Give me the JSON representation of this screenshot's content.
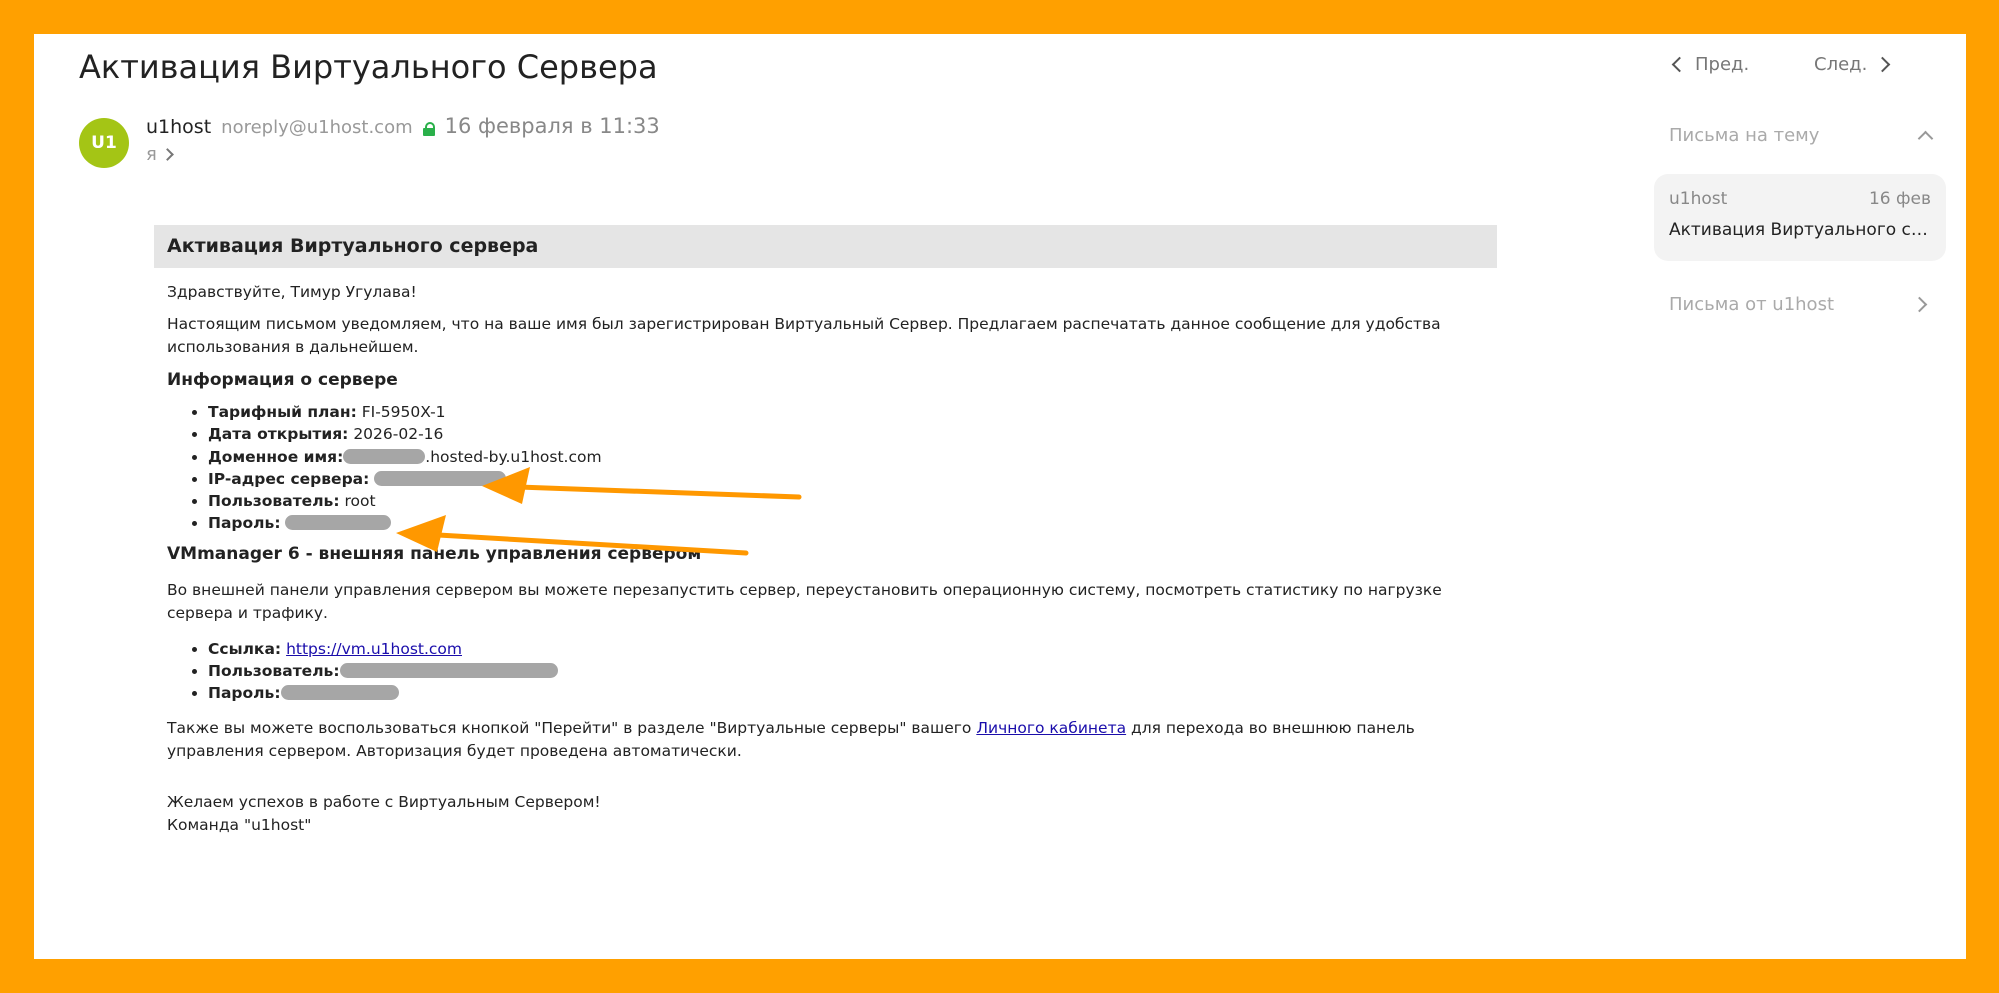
{
  "message": {
    "title": "Активация Виртуального Сервера",
    "avatar_initials": "U1",
    "sender_name": "u1host",
    "sender_email": "noreply@u1host.com",
    "date": "16 февраля в 11:33",
    "recipient": "я"
  },
  "body": {
    "header": "Активация Виртуального сервера",
    "greeting": "Здравствуйте, Тимур Угулава!",
    "intro": "Настоящим письмом уведомляем, что на ваше имя был зарегистрирован Виртуальный Сервер. Предлагаем распечатать данное сообщение для удобства использования в дальнейшем.",
    "server_info_title": "Информация о сервере",
    "server_info": {
      "plan_label": "Тарифный план:",
      "plan_value": "FI-5950X-1",
      "open_date_label": "Дата открытия:",
      "open_date_value": "2026-02-16",
      "domain_label": "Доменное имя:",
      "domain_suffix": ".hosted-by.u1host.com",
      "ip_label": "IP-адрес сервера:",
      "user_label": "Пользователь:",
      "user_value": "root",
      "password_label": "Пароль:"
    },
    "panel_title": "VMmanager 6 - внешняя панель управления сервером",
    "panel_desc": "Во внешней панели управления сервером вы можете перезапустить сервер, переустановить операционную систему, посмотреть статистику по нагрузке сервера и трафику.",
    "panel_info": {
      "link_label": "Ссылка:",
      "link_value": "https://vm.u1host.com",
      "user_label": "Пользователь:",
      "password_label": "Пароль:"
    },
    "also_before": "Также вы можете воспользоваться кнопкой \"Перейти\" в разделе \"Виртуальные серверы\" вашего ",
    "cabinet_link": "Личного кабинета",
    "also_after": " для перехода во внешнюю панель управления сервером. Авторизация будет проведена автоматически.",
    "closing": "Желаем успехов в работе с Виртуальным Сервером!",
    "signature": "Команда \"u1host\""
  },
  "sidebar": {
    "prev": "Пред.",
    "next": "След.",
    "thread_header": "Письма на тему",
    "thread_item": {
      "from": "u1host",
      "date": "16 фев",
      "subject": "Активация Виртуального сервера"
    },
    "from_sender": "Письма от u1host"
  },
  "colors": {
    "frame": "#FFA000",
    "avatar": "#A4C515",
    "arrow": "#FF9800",
    "link": "#1A0DAB",
    "lock": "#2AB04A"
  }
}
